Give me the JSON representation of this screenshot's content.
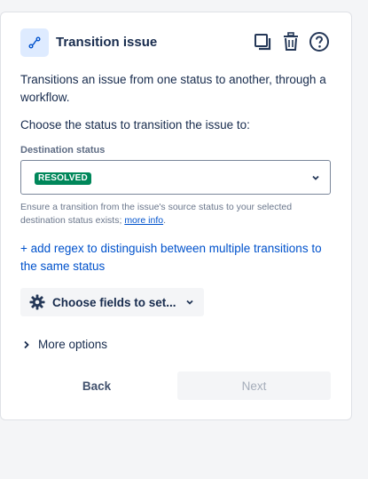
{
  "header": {
    "title": "Transition issue",
    "icons": [
      "transition-icon",
      "duplicate-icon",
      "trash-icon",
      "help-icon"
    ]
  },
  "description": "Transitions an issue from one status to another, through a workflow.",
  "prompt": "Choose the status to transition the issue to:",
  "destination": {
    "label": "Destination status",
    "selected_value": "RESOLVED",
    "lozenge_color": "#00875a",
    "help_text": "Ensure a transition from the issue's source status to your selected destination status exists; ",
    "help_link": "more info",
    "help_suffix": "."
  },
  "add_regex_link": "+ add regex to distinguish between multiple transitions to the same status",
  "choose_fields_button": "Choose fields to set...",
  "more_options": "More options",
  "footer": {
    "back_label": "Back",
    "next_label": "Next"
  },
  "colors": {
    "accent": "#0052cc",
    "text": "#172b4d",
    "subtle": "#6b778c"
  }
}
